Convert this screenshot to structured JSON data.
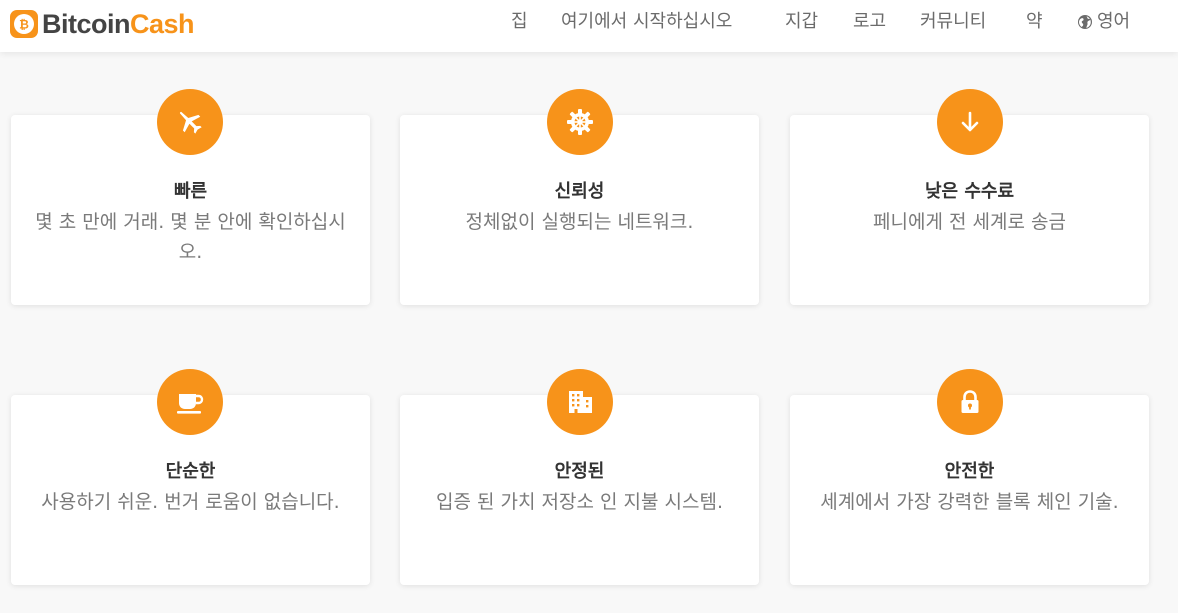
{
  "brand": {
    "name_part1": "Bitcoin",
    "name_part2": "Cash",
    "accent": "#f7931a",
    "logo_icon": "bitcoin-cash-logo-icon"
  },
  "nav": {
    "items": [
      {
        "label": "집"
      },
      {
        "label": "여기에서 시작하십시오"
      },
      {
        "label": "지갑"
      },
      {
        "label": "로고"
      },
      {
        "label": "커뮤니티"
      },
      {
        "label": "약"
      }
    ],
    "language": {
      "label": "영어",
      "icon": "globe-icon"
    }
  },
  "features": [
    {
      "icon": "jet-plane-icon",
      "title": "빠른",
      "description": "몇 초 만에 거래. 몇 분 안에 확인하십시오."
    },
    {
      "icon": "gear-icon",
      "title": "신뢰성",
      "description": "정체없이 실행되는 네트워크."
    },
    {
      "icon": "arrow-down-icon",
      "title": "낮은 수수료",
      "description": "페니에게 전 세계로 송금"
    },
    {
      "icon": "coffee-cup-icon",
      "title": "단순한",
      "description": "사용하기 쉬운. 번거 로움이 없습니다."
    },
    {
      "icon": "building-icon",
      "title": "안정된",
      "description": "입증 된 가치 저장소 인 지불 시스템."
    },
    {
      "icon": "lock-icon",
      "title": "안전한",
      "description": "세계에서 가장 강력한 블록 체인 기술."
    }
  ]
}
